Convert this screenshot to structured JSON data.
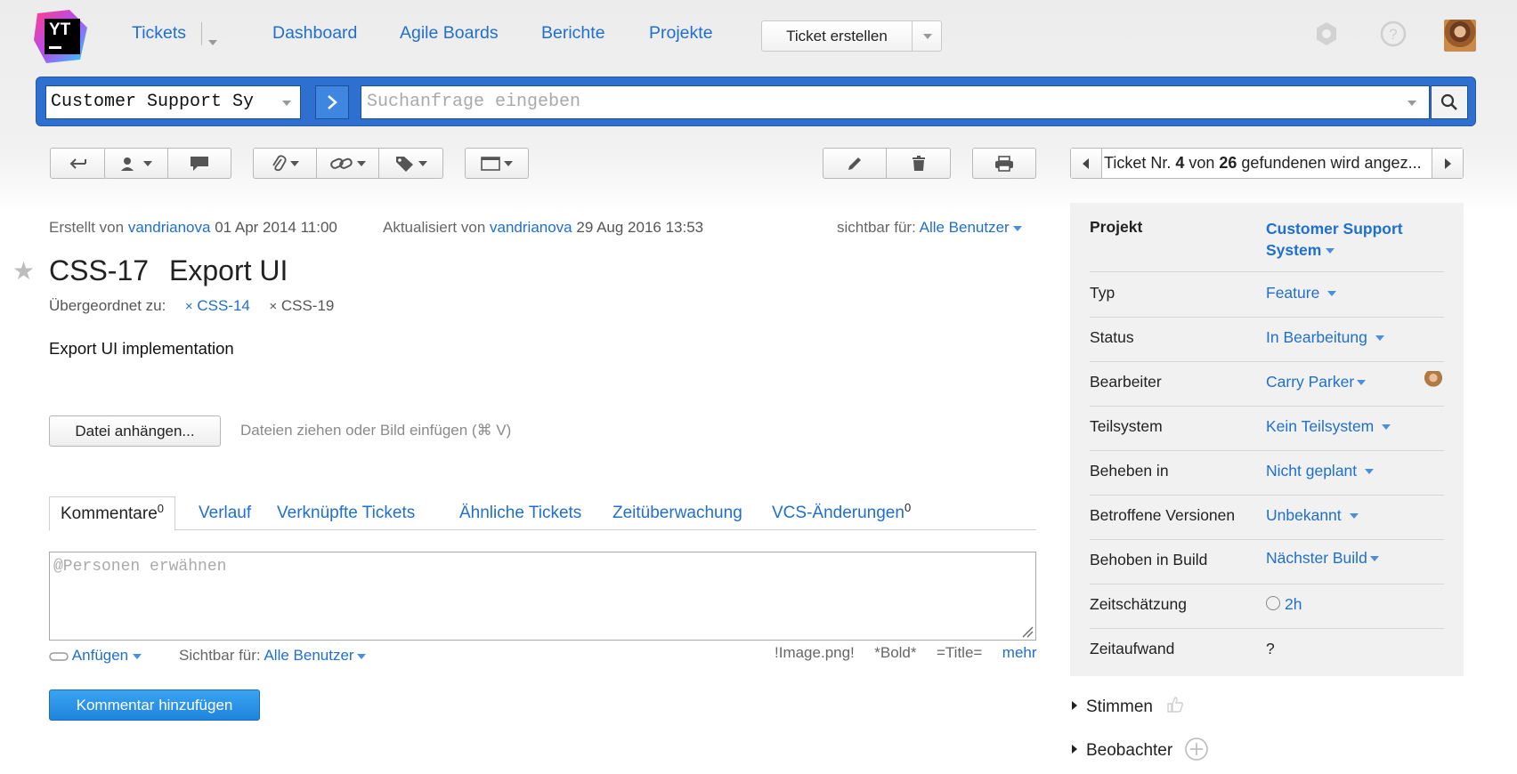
{
  "nav": {
    "logo_text": "YT",
    "tickets": "Tickets",
    "dashboard": "Dashboard",
    "agile_boards": "Agile Boards",
    "berichte": "Berichte",
    "projekte": "Projekte",
    "create_ticket": "Ticket erstellen"
  },
  "search": {
    "project": "Customer Support Sy",
    "placeholder": "Suchanfrage eingeben"
  },
  "pager": {
    "prefix": "Ticket Nr. ",
    "number": "4",
    "middle": " von ",
    "total": "26",
    "suffix": " gefundenen wird angez..."
  },
  "meta": {
    "created_label": "Erstellt von",
    "created_by": "vandrianova",
    "created_at": "01 Apr 2014 11:00",
    "updated_label": "Aktualisiert von",
    "updated_by": "vandrianova",
    "updated_at": "29 Aug 2016 13:53",
    "visible_label": "sichtbar für:",
    "visible_value": "Alle Benutzer"
  },
  "issue": {
    "id": "CSS-17",
    "title": "Export UI",
    "parent_label": "Übergeordnet zu:",
    "parent_links": [
      "CSS-14",
      "CSS-19"
    ],
    "description": "Export UI implementation"
  },
  "attach": {
    "button": "Datei anhängen...",
    "hint": "Dateien ziehen oder Bild einfügen (⌘ V)"
  },
  "tabs": [
    {
      "label": "Kommentare",
      "count": "0"
    },
    {
      "label": "Verlauf"
    },
    {
      "label": "Verknüpfte Tickets"
    },
    {
      "label": "Ähnliche Tickets"
    },
    {
      "label": "Zeitüberwachung"
    },
    {
      "label": "VCS-Änderungen",
      "count": "0"
    }
  ],
  "comment": {
    "placeholder": "@Personen erwähnen",
    "attach": "Anfügen",
    "visible_label": "Sichtbar für:",
    "visible_value": "Alle Benutzer",
    "hint_image": "!Image.png!",
    "hint_bold": "*Bold*",
    "hint_title": "=Title=",
    "more": "mehr",
    "submit": "Kommentar hinzufügen"
  },
  "fields": [
    {
      "label": "Projekt",
      "value_line1": "Customer Support",
      "value_line2": "System"
    },
    {
      "label": "Typ",
      "value": "Feature"
    },
    {
      "label": "Status",
      "value": "In Bearbeitung"
    },
    {
      "label": "Bearbeiter",
      "value": "Carry Parker"
    },
    {
      "label": "Teilsystem",
      "value": "Kein Teilsystem"
    },
    {
      "label": "Beheben in",
      "value": "Nicht geplant"
    },
    {
      "label": "Betroffene Versionen",
      "value": "Unbekannt"
    },
    {
      "label": "Behoben in Build",
      "value": "Nächster Build"
    },
    {
      "label": "Zeitschätzung",
      "value": "2h"
    },
    {
      "label": "Zeitaufwand",
      "value": "?"
    }
  ],
  "sections": {
    "votes": "Stimmen",
    "watchers": "Beobachter"
  },
  "colors": {
    "link": "#1f6fd0",
    "searchbar": "#2f6fcf",
    "primary_button": "#1f84dc"
  }
}
